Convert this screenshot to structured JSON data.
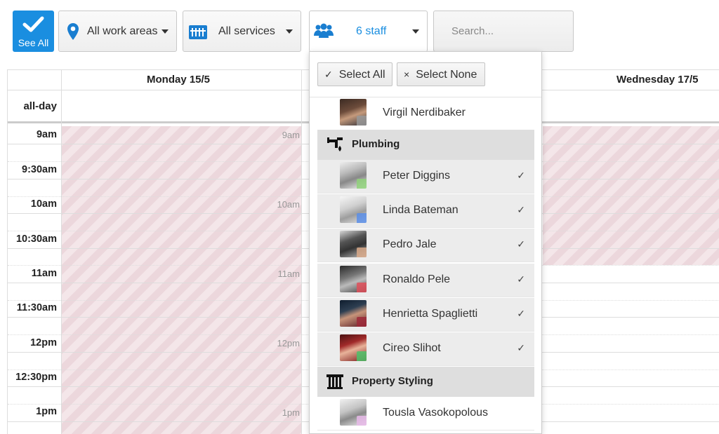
{
  "toolbar": {
    "see_all_label": "See All",
    "work_areas_label": "All work areas",
    "services_label": "All services",
    "staff_label": "6 staff",
    "search_placeholder": "Search..."
  },
  "calendar": {
    "days": [
      "Monday 15/5",
      "Wednesday 17/5"
    ],
    "all_day_label": "all-day",
    "time_labels": [
      "9am",
      "9:30am",
      "10am",
      "10:30am",
      "11am",
      "11:30am",
      "12pm",
      "12:30pm",
      "1pm"
    ],
    "slot_labels": [
      "9am",
      "10am",
      "11am",
      "12pm",
      "1pm"
    ]
  },
  "staff_dropdown": {
    "select_all_label": "Select All",
    "select_all_mark": "✓",
    "select_none_label": "Select None",
    "select_none_mark": "×",
    "check_mark": "✓",
    "ungrouped": [
      {
        "name": "Virgil Nerdibaker",
        "badge_color": "#999999",
        "selected": false
      }
    ],
    "groups": [
      {
        "name": "Plumbing",
        "icon": "faucet-icon",
        "members": [
          {
            "name": "Peter Diggins",
            "badge_color": "#8fd17a",
            "selected": true
          },
          {
            "name": "Linda Bateman",
            "badge_color": "#5b8ee8",
            "selected": true
          },
          {
            "name": "Pedro Jale",
            "badge_color": "#d8a98a",
            "selected": true
          },
          {
            "name": "Ronaldo Pele",
            "badge_color": "#e0505a",
            "selected": true
          },
          {
            "name": "Henrietta Spaglietti",
            "badge_color": "#9e2a3a",
            "selected": true
          },
          {
            "name": "Cireo Slihot",
            "badge_color": "#4cc26a",
            "selected": true
          }
        ]
      },
      {
        "name": "Property Styling",
        "icon": "pillar-icon",
        "members": [
          {
            "name": "Tousla Vasokopolous",
            "badge_color": "#e6b8e8",
            "selected": false
          }
        ]
      }
    ]
  },
  "colors": {
    "accent": "#1a8ee0",
    "unavailable_stripe": "#ecd7dc"
  }
}
